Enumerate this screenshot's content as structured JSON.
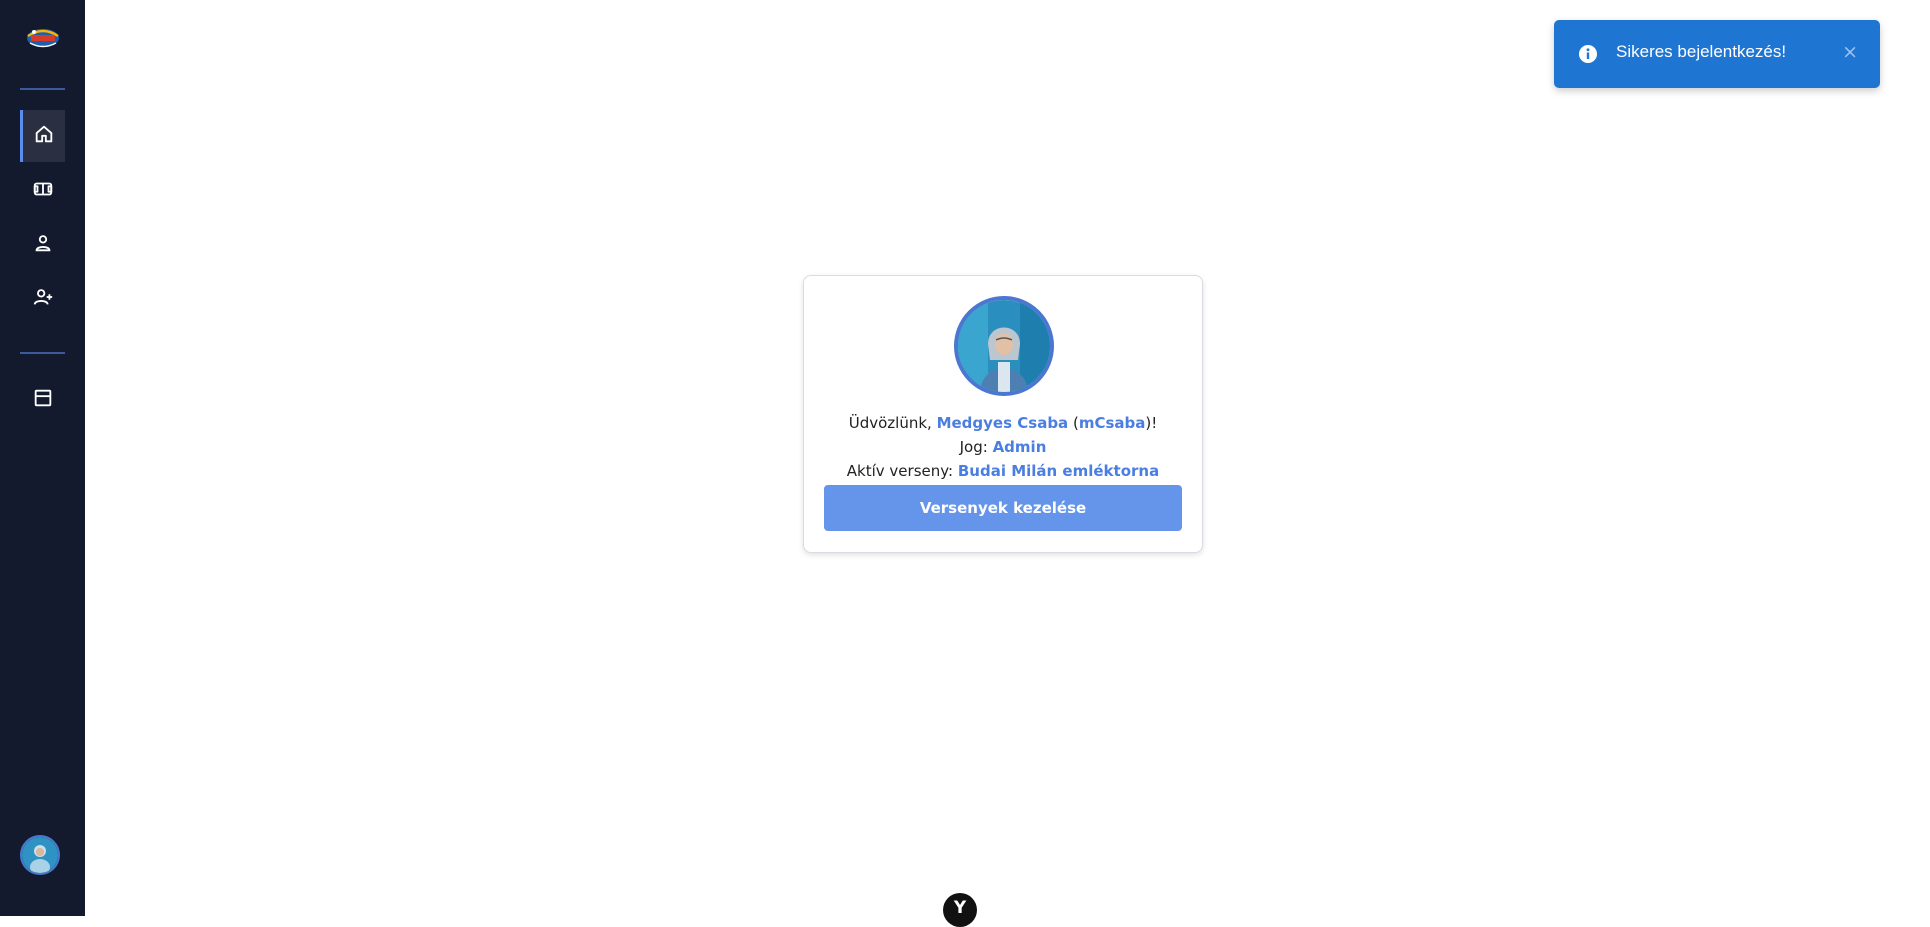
{
  "sidebar": {
    "logo_icon": "sports-logo-icon",
    "items": [
      {
        "icon": "home-icon",
        "active": true
      },
      {
        "icon": "competition-icon",
        "active": false
      },
      {
        "icon": "user-icon",
        "active": false
      },
      {
        "icon": "add-user-icon",
        "active": false
      },
      {
        "icon": "archive-icon",
        "active": false
      }
    ],
    "avatar_icon": "user-avatar"
  },
  "welcome_card": {
    "greeting_prefix": "Üdvözlünk, ",
    "full_name": "Medgyes Csaba",
    "paren_open": " (",
    "username": "mCsaba",
    "paren_close": ")!",
    "role_label": "Jog: ",
    "role_value": "Admin",
    "active_comp_label": "Aktív verseny: ",
    "active_comp_value": "Budai Milán emléktorna",
    "manage_button": "Versenyek kezelése"
  },
  "toast": {
    "message": "Sikeres bejelentkezés!",
    "close": "×",
    "icon": "info-icon"
  },
  "bottom_badge": {
    "letter": "Y"
  },
  "colors": {
    "sidebar_bg": "#141a2e",
    "accent": "#4a7ee0",
    "button_bg": "#6595ea",
    "toast_bg": "#1f76d2"
  }
}
